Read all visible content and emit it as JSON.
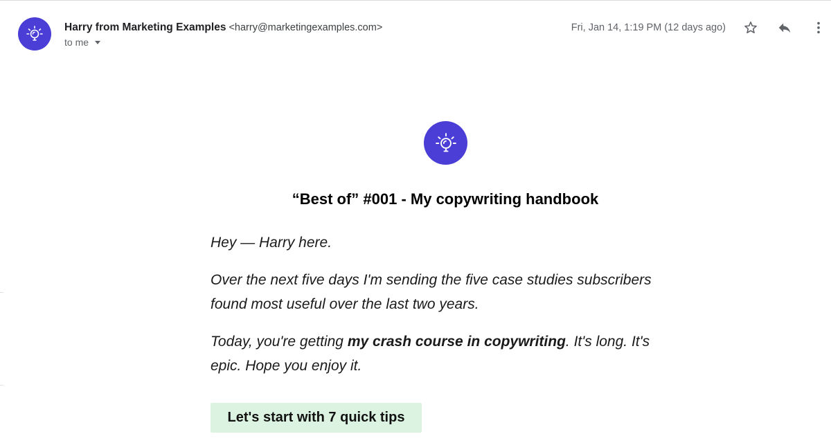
{
  "email": {
    "sender_name": "Harry from Marketing Examples",
    "sender_email": "<harry@marketingexamples.com>",
    "recipient": "to me",
    "timestamp": "Fri, Jan 14, 1:19 PM (12 days ago)"
  },
  "toolbar": {
    "star_icon": "star-outline-icon",
    "reply_icon": "reply-icon",
    "more_icon": "more-vertical-icon"
  },
  "content": {
    "logo_icon": "lightbulb-icon",
    "title": "“Best of” #001 - My copywriting handbook",
    "greeting": "Hey — Harry here.",
    "paragraph_1": "Over the next five days I'm sending the five case studies subscribers found most useful over the last two years.",
    "paragraph_2_before": "Today, you're getting ",
    "paragraph_2_bold": "my crash course in copywriting",
    "paragraph_2_after": ". It's long. It's epic. Hope you enjoy it.",
    "cta_label": "Let's start with 7 quick tips"
  },
  "colors": {
    "brand_purple": "#4a3ed6",
    "cta_background": "#dcf3e1"
  }
}
